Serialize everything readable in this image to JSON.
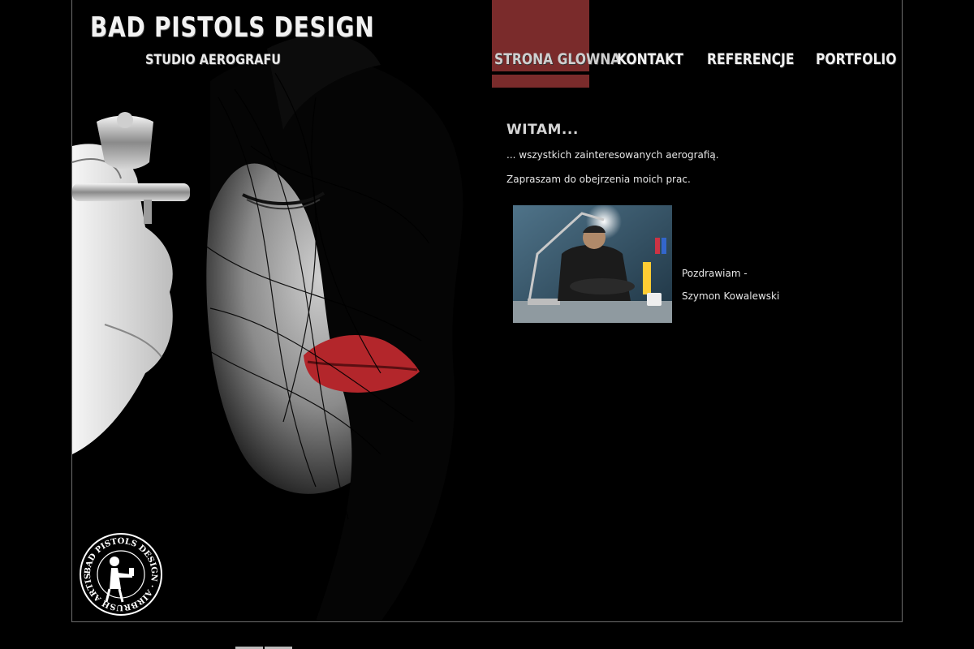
{
  "brand": {
    "title": "BAD PISTOLS  DESIGN",
    "subtitle": "STUDIO AEROGRAFU",
    "emblem_text": "BAD PISTOLS DESIGN · AIRBRUSH ARTIST · "
  },
  "nav": {
    "items": [
      {
        "label": "STRONA GLOWNA",
        "active": true
      },
      {
        "label": "KONTAKT",
        "active": false
      },
      {
        "label": "REFERENCJE",
        "active": false
      },
      {
        "label": "PORTFOLIO",
        "active": false
      }
    ]
  },
  "content": {
    "heading": "WITAM...",
    "line1": "... wszystkich zainteresowanych aerografią.",
    "line2": "Zapraszam do obejrzenia moich prac.",
    "greeting": "Pozdrawiam -",
    "signature": "Szymon Kowalewski"
  },
  "colors": {
    "background": "#000000",
    "nav_active": "#7a2b2b",
    "frame_border": "#6e6e6e",
    "lips": "#b3262b"
  }
}
